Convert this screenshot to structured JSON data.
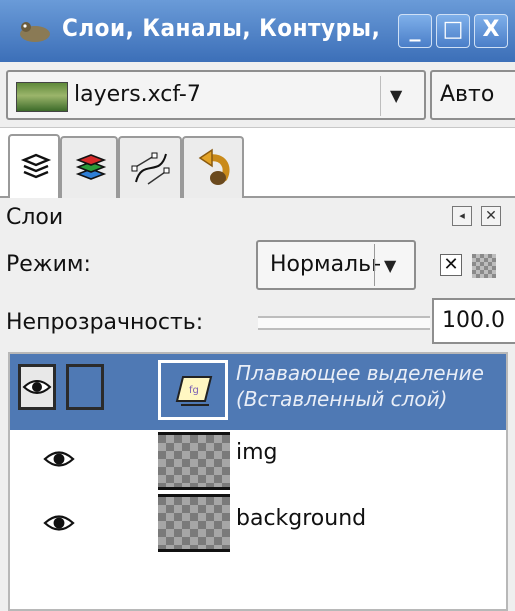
{
  "window": {
    "title": "Слои, Каналы, Контуры,",
    "icon": "gimp-wilber-icon",
    "buttons": {
      "minimize": "_",
      "maximize": "□",
      "close": "X"
    }
  },
  "image_selector": {
    "value": "layers.xcf-7",
    "auto_label": "Авто"
  },
  "tabs": [
    {
      "name": "tab-layers",
      "icon": "layers-icon",
      "active": true
    },
    {
      "name": "tab-channels",
      "icon": "channels-icon",
      "active": false
    },
    {
      "name": "tab-paths",
      "icon": "paths-icon",
      "active": false
    },
    {
      "name": "tab-undo",
      "icon": "undo-history-icon",
      "active": false
    }
  ],
  "panel": {
    "title": "Слои",
    "mode_label": "Режим:",
    "mode_value": "Нормальный",
    "keep_transparency": "✕",
    "opacity_label": "Непрозрачность:",
    "opacity_value": "100.0"
  },
  "layers": [
    {
      "name_line1": "Плавающее выделение",
      "name_line2": "(Вставленный слой)",
      "visible": true,
      "selected": true,
      "floating": true
    },
    {
      "name": "img",
      "visible": true,
      "selected": false
    },
    {
      "name": "background",
      "visible": true,
      "selected": false
    }
  ],
  "colors": {
    "titlebar": "#3c6fb8",
    "selection": "#4f79b4",
    "panel_bg": "#efefef"
  }
}
